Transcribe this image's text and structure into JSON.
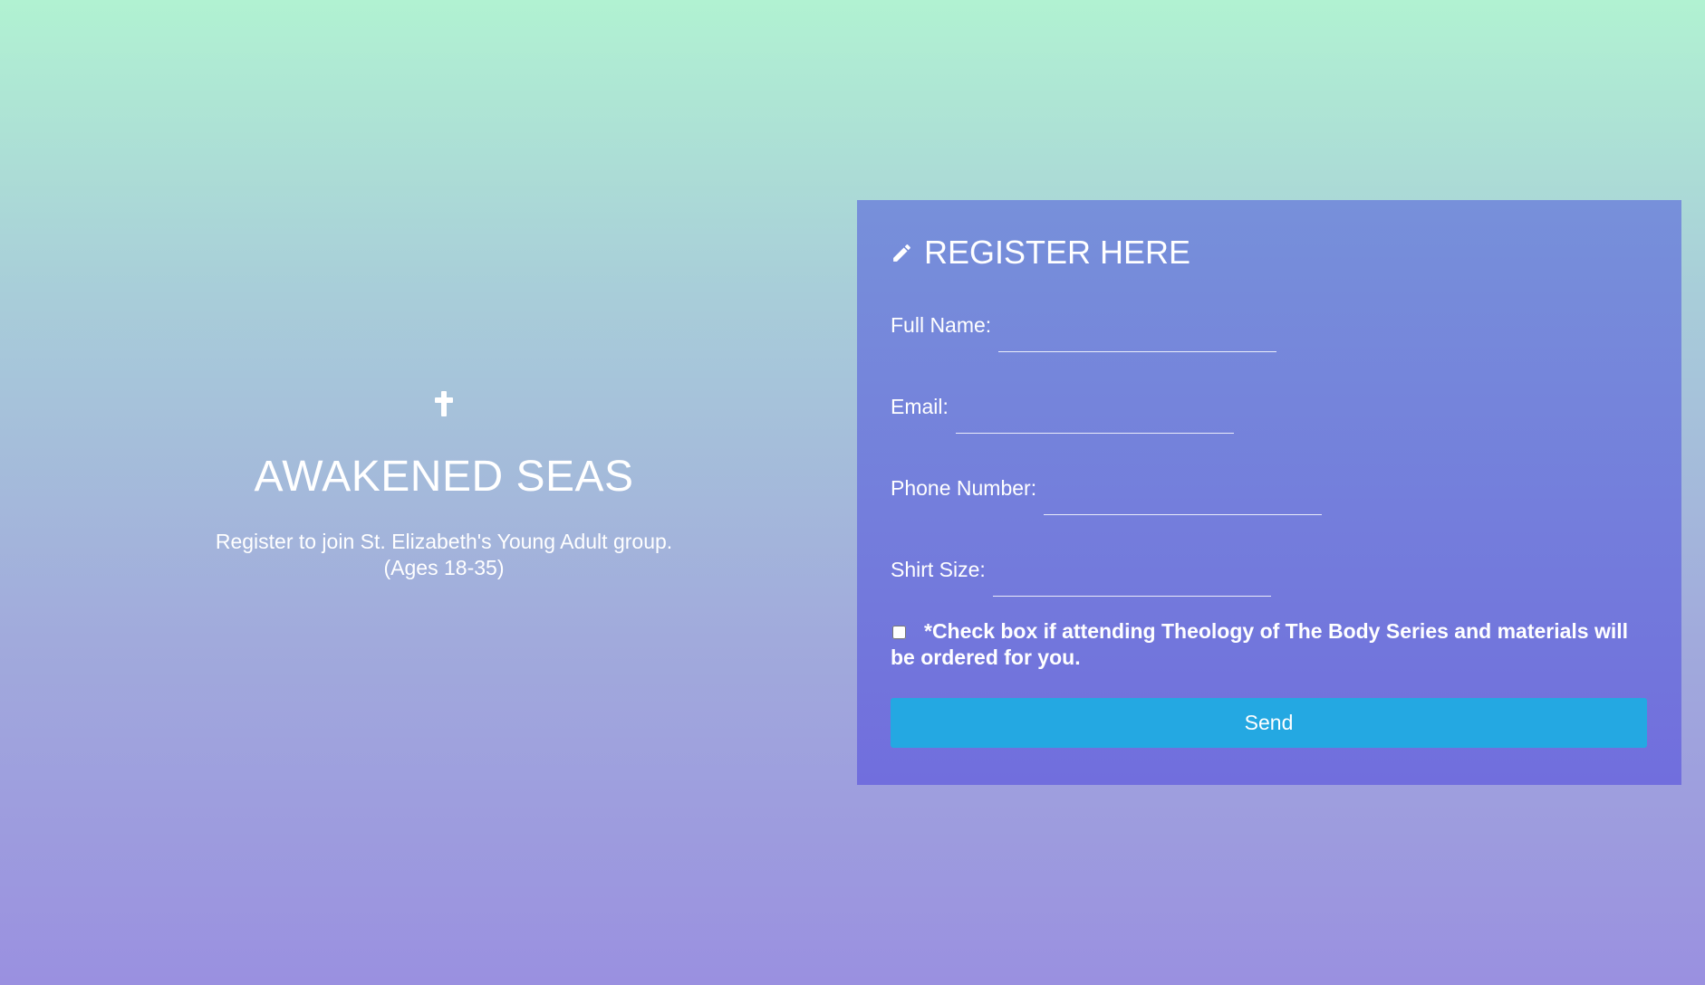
{
  "hero": {
    "icon": "cross-icon",
    "title": "AWAKENED SEAS",
    "subtitle_line1": "Register to join St. Elizabeth's Young Adult group.",
    "subtitle_line2": "(Ages 18-35)"
  },
  "form": {
    "title_icon": "pencil-icon",
    "title": "REGISTER HERE",
    "fields": [
      {
        "label": "Full Name:",
        "value": "",
        "placeholder": ""
      },
      {
        "label": "Email:",
        "value": "",
        "placeholder": ""
      },
      {
        "label": "Phone Number:",
        "value": "",
        "placeholder": ""
      },
      {
        "label": "Shirt Size:",
        "value": "",
        "placeholder": ""
      }
    ],
    "checkbox_checked": false,
    "checkbox_label": "*Check box if attending Theology of The Body Series and materials will be ordered for you.",
    "submit_label": "Send"
  },
  "colors": {
    "panel_top": "#7790da",
    "panel_bottom": "#716edd",
    "button": "#24a8e2",
    "background_top": "#b1f2d2",
    "background_bottom": "#9a90e0"
  }
}
